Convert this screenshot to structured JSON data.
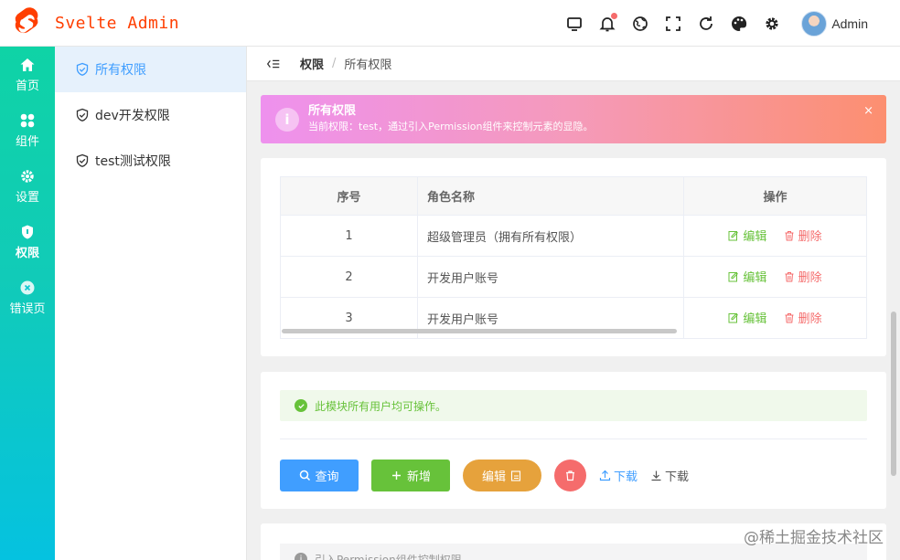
{
  "app": {
    "title": "Svelte Admin",
    "brand_color": "#ff3e00"
  },
  "header": {
    "tools": [
      {
        "icon": "monitor-icon"
      },
      {
        "icon": "bell-icon",
        "has_dot": true
      },
      {
        "icon": "language-icon"
      },
      {
        "icon": "fullscreen-icon"
      },
      {
        "icon": "refresh-icon"
      },
      {
        "icon": "palette-icon"
      },
      {
        "icon": "gear-icon"
      }
    ],
    "user": {
      "name": "Admin"
    }
  },
  "rail": {
    "items": [
      {
        "label": "首页",
        "icon": "home-icon"
      },
      {
        "label": "组件",
        "icon": "components-icon"
      },
      {
        "label": "设置",
        "icon": "settings-icon"
      },
      {
        "label": "权限",
        "icon": "permission-icon",
        "active": true
      },
      {
        "label": "错误页",
        "icon": "error-icon"
      }
    ]
  },
  "submenu": {
    "items": [
      {
        "label": "所有权限",
        "active": true
      },
      {
        "label": "dev开发权限"
      },
      {
        "label": "test测试权限"
      }
    ]
  },
  "breadcrumb": {
    "parent": "权限",
    "separator": "/",
    "current": "所有权限"
  },
  "alert": {
    "title": "所有权限",
    "description": "当前权限：test，通过引入Permission组件来控制元素的显隐。",
    "close": "×"
  },
  "table": {
    "headers": [
      "序号",
      "角色名称",
      "操作"
    ],
    "rows": [
      {
        "index": "1",
        "name": "超级管理员（拥有所有权限）"
      },
      {
        "index": "2",
        "name": "开发用户账号"
      },
      {
        "index": "3",
        "name": "开发用户账号"
      }
    ],
    "edit_label": "编辑",
    "delete_label": "删除"
  },
  "success_tip": "此模块所有用户均可操作。",
  "buttons": {
    "query": "查询",
    "add": "新增",
    "edit": "编辑",
    "upload": "下载",
    "download": "下载"
  },
  "info_tip": "引入Permission组件控制权限",
  "watermark": "@稀土掘金技术社区"
}
